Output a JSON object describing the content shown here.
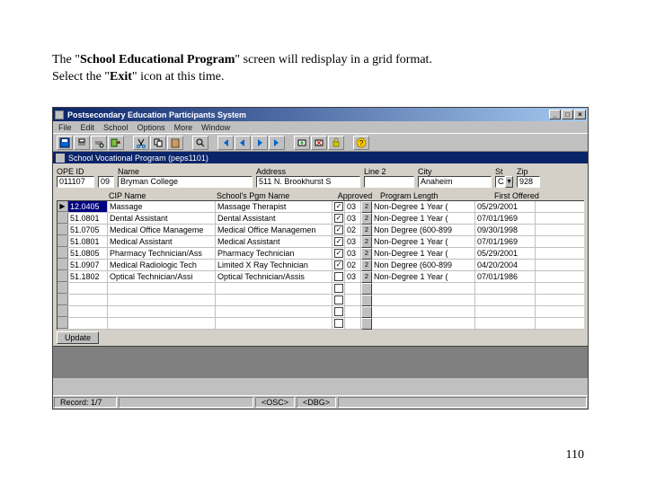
{
  "instruction": {
    "line1_a": "The \"",
    "line1_bold": "School  Educational Program",
    "line1_b": "\" screen will redisplay in a grid format.",
    "line2_a": "Select the \"",
    "line2_bold": "Exit",
    "line2_b": "\" icon at this time."
  },
  "app_title": "Postsecondary Education Participants System",
  "menu": {
    "m0": "File",
    "m1": "Edit",
    "m2": "School",
    "m3": "Options",
    "m4": "More",
    "m5": "Window"
  },
  "child_title": "School Vocational Program (peps1101)",
  "header": {
    "ope_lbl": "OPE ID",
    "ope_val": "011107",
    "ope_suf": "09",
    "name_lbl": "Name",
    "name_val": "Bryman College",
    "addr_lbl": "Address",
    "addr_val": "511 N. Brookhurst S",
    "line2_lbl": "Line 2",
    "line2_val": "",
    "city_lbl": "City",
    "city_val": "Anaheim",
    "st_lbl": "St",
    "st_val": "CA",
    "zip_lbl": "Zip",
    "zip_val": "928"
  },
  "grid_headers": {
    "cip": "CIP Name",
    "pgm": "School's Pgm Name",
    "appr": "Approved",
    "plen": "Program Length",
    "first": "First Offered"
  },
  "rows": [
    {
      "cip": "12.0405",
      "name": "Massage",
      "pgm": "Massage Therapist",
      "appr": true,
      "seq": "03",
      "ddn": "2",
      "plen": "Non-Degree 1 Year (",
      "date": "05/29/2001",
      "sel": true
    },
    {
      "cip": "51.0801",
      "name": "Dental Assistant",
      "pgm": "Dental Assistant",
      "appr": true,
      "seq": "03",
      "ddn": "2",
      "plen": "Non-Degree 1 Year (",
      "date": "07/01/1969"
    },
    {
      "cip": "51.0705",
      "name": "Medical Office Manageme",
      "pgm": "Medical Office Managemen",
      "appr": true,
      "seq": "02",
      "ddn": "2",
      "plen": "Non Degree (600-899",
      "date": "09/30/1998"
    },
    {
      "cip": "51.0801",
      "name": "Medical Assistant",
      "pgm": "Medical Assistant",
      "appr": true,
      "seq": "03",
      "ddn": "2",
      "plen": "Non-Degree 1 Year (",
      "date": "07/01/1969"
    },
    {
      "cip": "51.0805",
      "name": "Pharmacy Technician/Ass",
      "pgm": "Pharmacy Technician",
      "appr": true,
      "seq": "03",
      "ddn": "2",
      "plen": "Non-Degree 1 Year (",
      "date": "05/29/2001"
    },
    {
      "cip": "51.0907",
      "name": "Medical Radiologic Tech",
      "pgm": "Limited X Ray Technician",
      "appr": true,
      "seq": "02",
      "ddn": "2",
      "plen": "Non Degree (600-899",
      "date": "04/20/2004"
    },
    {
      "cip": "51.1802",
      "name": "Optical Technician/Assi",
      "pgm": "Optical Technician/Assis",
      "appr": false,
      "seq": "03",
      "ddn": "2",
      "plen": "Non-Degree 1 Year (",
      "date": "07/01/1986"
    }
  ],
  "update_btn": "Update",
  "status": {
    "record": "Record: 1/7",
    "osc": "<OSC>",
    "dbg": "<DBG>"
  },
  "page_number": "110"
}
